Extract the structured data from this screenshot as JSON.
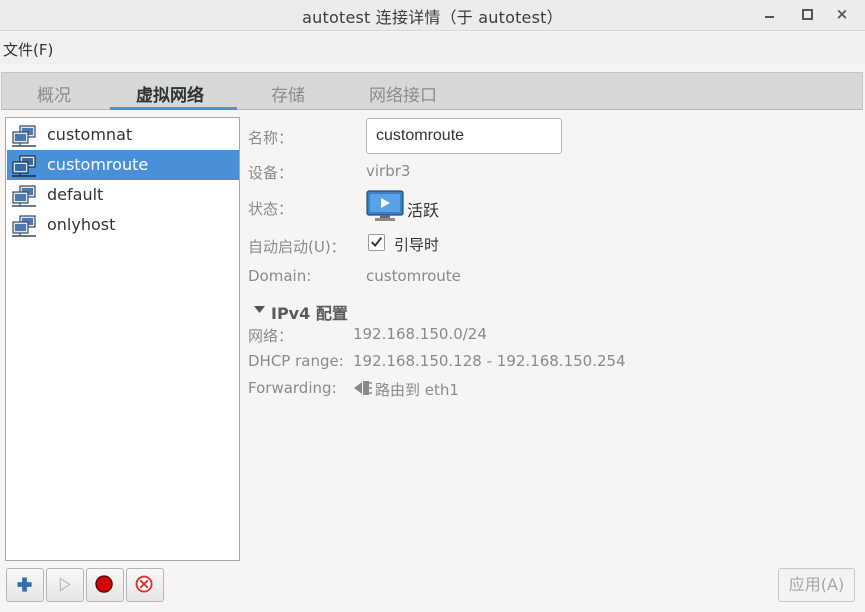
{
  "window": {
    "title": "autotest 连接详情（于 autotest）",
    "close_glyph": "×"
  },
  "menubar": {
    "file_label": "文件(F)"
  },
  "tabs": [
    {
      "label": "概况",
      "active": false
    },
    {
      "label": "虚拟网络",
      "active": true
    },
    {
      "label": "存储",
      "active": false
    },
    {
      "label": "网络接口",
      "active": false
    }
  ],
  "networks": [
    {
      "name": "customnat",
      "selected": false,
      "icon": "network-icon"
    },
    {
      "name": "customroute",
      "selected": true,
      "icon": "network-icon"
    },
    {
      "name": "default",
      "selected": false,
      "icon": "network-icon"
    },
    {
      "name": "onlyhost",
      "selected": false,
      "icon": "network-icon"
    }
  ],
  "details": {
    "name_label": "名称：",
    "name_value": "customroute",
    "device_label": "设备：",
    "device_value": "virbr3",
    "state_label": "状态：",
    "state_value": "活跃",
    "autostart_label": "自动启动(U)：",
    "autostart_checked": true,
    "autostart_value": "引导时",
    "domain_label": "Domain:",
    "domain_value": "customroute"
  },
  "ipv4": {
    "section_title": "IPv4 配置",
    "network_label": "网络：",
    "network_value": "192.168.150.0/24",
    "dhcp_label": "DHCP range:",
    "dhcp_value": "192.168.150.128 - 192.168.150.254",
    "forwarding_label": "Forwarding:",
    "forwarding_value": "路由到 eth1"
  },
  "buttons": {
    "add_icon": "plus-icon",
    "start_icon": "play-icon",
    "stop_icon": "stop-record-icon",
    "delete_icon": "delete-icon",
    "apply_label": "应用(A)"
  },
  "colors": {
    "accent": "#4a90d9",
    "stop_red": "#d40000",
    "delete_red": "#e03030"
  }
}
